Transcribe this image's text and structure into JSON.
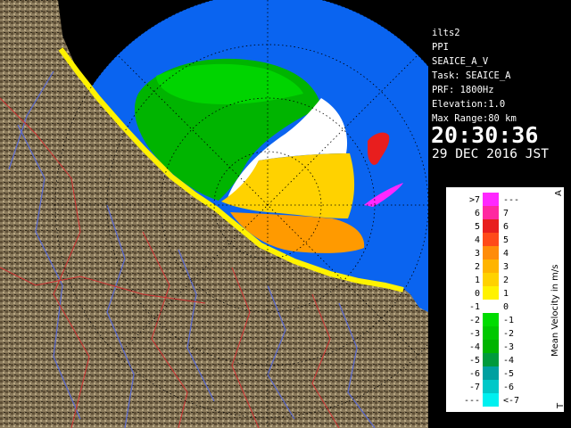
{
  "info": {
    "radar_name": "ilts2",
    "scan_mode": "PPI",
    "product": "SEAICE_A_V",
    "task": "Task: SEAICE_A",
    "prf": "PRF: 1800Hz",
    "elevation": "Elevation:1.0",
    "max_range": "Max Range:80 km",
    "time": "20:30:36",
    "date": "29 DEC 2016 JST"
  },
  "legend": {
    "title": "Mean Velocity in m/s",
    "corner_top": "A",
    "corner_bottom": "T",
    "rows": [
      {
        "left": ">7",
        "right": "---",
        "color": "#ff28ff"
      },
      {
        "left": "6",
        "right": "7",
        "color": "#ff28a0"
      },
      {
        "left": "5",
        "right": "6",
        "color": "#e81e1e"
      },
      {
        "left": "4",
        "right": "5",
        "color": "#ff4a1a"
      },
      {
        "left": "3",
        "right": "4",
        "color": "#ff8c0a"
      },
      {
        "left": "2",
        "right": "3",
        "color": "#ffb400"
      },
      {
        "left": "1",
        "right": "2",
        "color": "#ffd200"
      },
      {
        "left": "0",
        "right": "1",
        "color": "#fff200"
      },
      {
        "left": "-1",
        "right": "0",
        "color": "#ffffff"
      },
      {
        "left": "-2",
        "right": "-1",
        "color": "#00dc00"
      },
      {
        "left": "-3",
        "right": "-2",
        "color": "#00c800"
      },
      {
        "left": "-4",
        "right": "-3",
        "color": "#00b400"
      },
      {
        "left": "-5",
        "right": "-4",
        "color": "#009a3c"
      },
      {
        "left": "-6",
        "right": "-5",
        "color": "#00a0a0"
      },
      {
        "left": "-7",
        "right": "-6",
        "color": "#00c8c8"
      },
      {
        "left": "---",
        "right": "<-7",
        "color": "#00f0f0"
      }
    ]
  },
  "colors": {
    "sea": "#0a64f0",
    "land": "#8c7a5a",
    "coast_echo": "#fff200",
    "river": "#5a6ad2",
    "border": "#d23232",
    "range_ring": "#000000"
  }
}
